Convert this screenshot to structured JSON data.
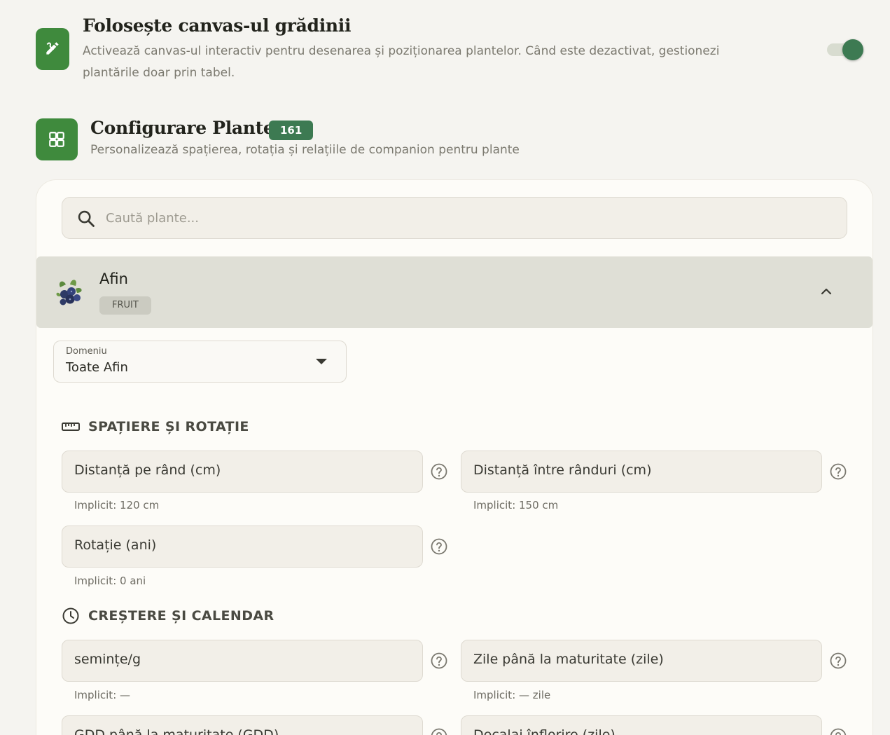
{
  "canvas_setting": {
    "title": "Folosește canvas-ul grădinii",
    "description": "Activează canvas-ul interactiv pentru desenarea și poziționarea plantelor. Când este dezactivat, gestionezi plantările doar prin tabel.",
    "toggle_on": true
  },
  "plants_section": {
    "title": "Configurare Plante",
    "count": "161",
    "subtitle": "Personalizează spațierea, rotația și relațiile de companion pentru plante"
  },
  "search": {
    "placeholder": "Caută plante..."
  },
  "plant": {
    "name": "Afin",
    "category": "FRUIT",
    "expanded": true,
    "icon": "blueberry-icon"
  },
  "domain_select": {
    "label": "Domeniu",
    "value": "Toate Afin"
  },
  "spacing_group": {
    "title": "SPAȚIERE ȘI ROTAȚIE",
    "icon": "ruler-icon",
    "fields": [
      {
        "label": "Distanță pe rând (cm)",
        "hint": "Implicit: 120 cm"
      },
      {
        "label": "Distanță între rânduri (cm)",
        "hint": "Implicit: 150 cm"
      },
      {
        "label": "Rotație (ani)",
        "hint": "Implicit: 0 ani"
      }
    ]
  },
  "growth_group": {
    "title": "CREȘTERE ȘI CALENDAR",
    "icon": "clock-icon",
    "fields": [
      {
        "label": "semințe/g",
        "hint": "Implicit: —"
      },
      {
        "label": "Zile până la maturitate (zile)",
        "hint": "Implicit: — zile"
      },
      {
        "label": "GDD până la maturitate (GDD)"
      },
      {
        "label": "Decalaj înflorire (zile)"
      }
    ]
  },
  "colors": {
    "accent": "#3f8a3d",
    "badge": "#3d7a52",
    "background": "#f5f4f0",
    "card": "#fdfcf8"
  }
}
